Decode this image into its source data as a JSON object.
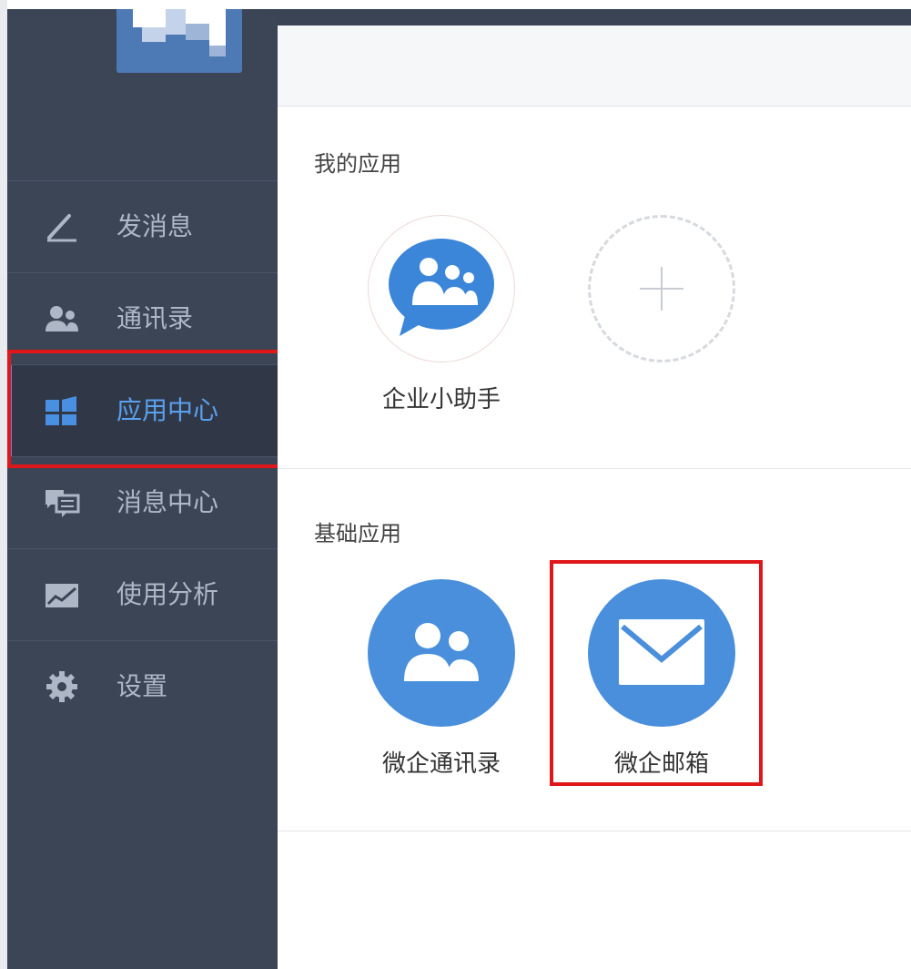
{
  "sidebar": {
    "items": [
      {
        "label": "发消息",
        "icon": "compose-icon"
      },
      {
        "label": "通讯录",
        "icon": "contacts-icon"
      },
      {
        "label": "应用中心",
        "icon": "app-center-icon",
        "active": true
      },
      {
        "label": "消息中心",
        "icon": "message-center-icon"
      },
      {
        "label": "使用分析",
        "icon": "analytics-icon"
      },
      {
        "label": "设置",
        "icon": "gear-icon"
      }
    ]
  },
  "main": {
    "my_apps": {
      "title": "我的应用",
      "apps": [
        {
          "name": "企业小助手",
          "icon": "assistant-icon"
        },
        {
          "name": "",
          "icon": "add-icon"
        }
      ]
    },
    "basic_apps": {
      "title": "基础应用",
      "apps": [
        {
          "name": "微企通讯录",
          "icon": "contacts-icon"
        },
        {
          "name": "微企邮箱",
          "icon": "mail-icon"
        }
      ]
    }
  },
  "colors": {
    "sidebar_bg": "#3c4556",
    "accent": "#4a8fdc",
    "highlight": "#e0161b"
  }
}
